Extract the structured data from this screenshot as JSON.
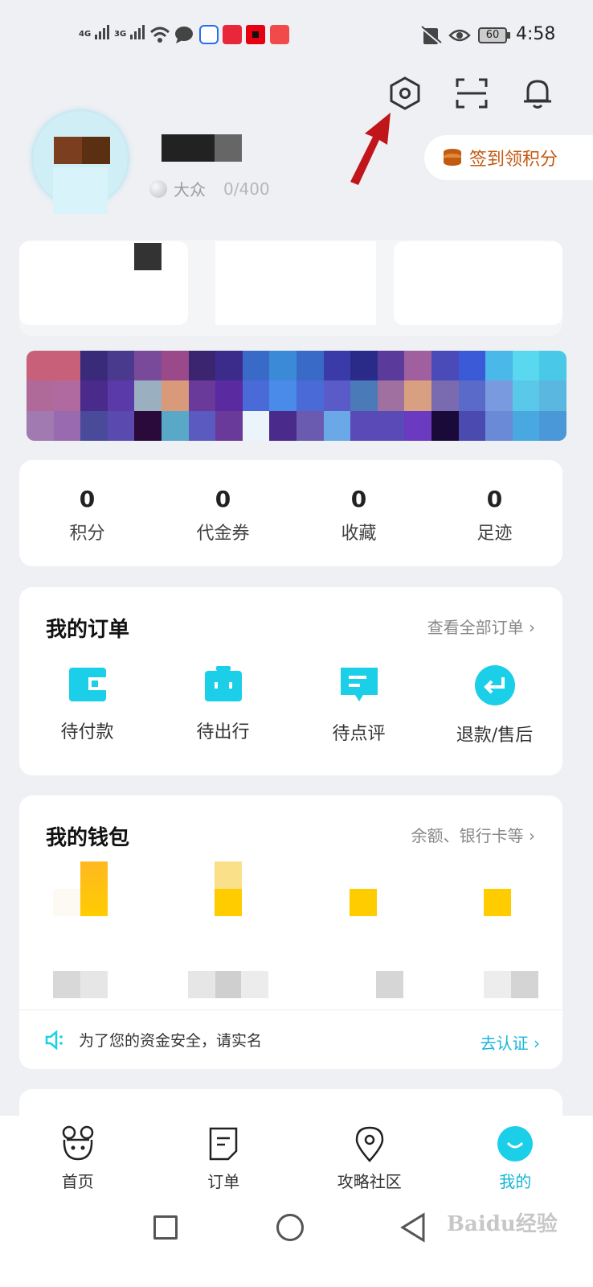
{
  "status_bar": {
    "signal1_label": "4G",
    "signal2_label": "3G",
    "battery": "60",
    "time": "4:58"
  },
  "profile": {
    "level": "大众",
    "points_progress": "0/400",
    "checkin_label": "签到领积分"
  },
  "stats": [
    {
      "value": "0",
      "label": "积分"
    },
    {
      "value": "0",
      "label": "代金券"
    },
    {
      "value": "0",
      "label": "收藏"
    },
    {
      "value": "0",
      "label": "足迹"
    }
  ],
  "orders": {
    "title": "我的订单",
    "view_all": "查看全部订单",
    "items": [
      {
        "label": "待付款",
        "icon": "wallet-icon"
      },
      {
        "label": "待出行",
        "icon": "suitcase-icon"
      },
      {
        "label": "待点评",
        "icon": "comment-icon"
      },
      {
        "label": "退款/售后",
        "icon": "refund-icon"
      }
    ]
  },
  "wallet": {
    "title": "我的钱包",
    "link": "余额、银行卡等",
    "notice": "为了您的资金安全，请实名",
    "verify": "去认证"
  },
  "bottom_nav": [
    {
      "label": "首页",
      "icon": "home-icon"
    },
    {
      "label": "订单",
      "icon": "order-icon"
    },
    {
      "label": "攻略社区",
      "icon": "location-icon"
    },
    {
      "label": "我的",
      "icon": "profile-icon"
    }
  ],
  "watermark": "Baidu经验",
  "colors": {
    "accent": "#1ccfe8",
    "checkin": "#c25a12",
    "arrow": "#c0161b",
    "wallet": "#ffcc00"
  }
}
